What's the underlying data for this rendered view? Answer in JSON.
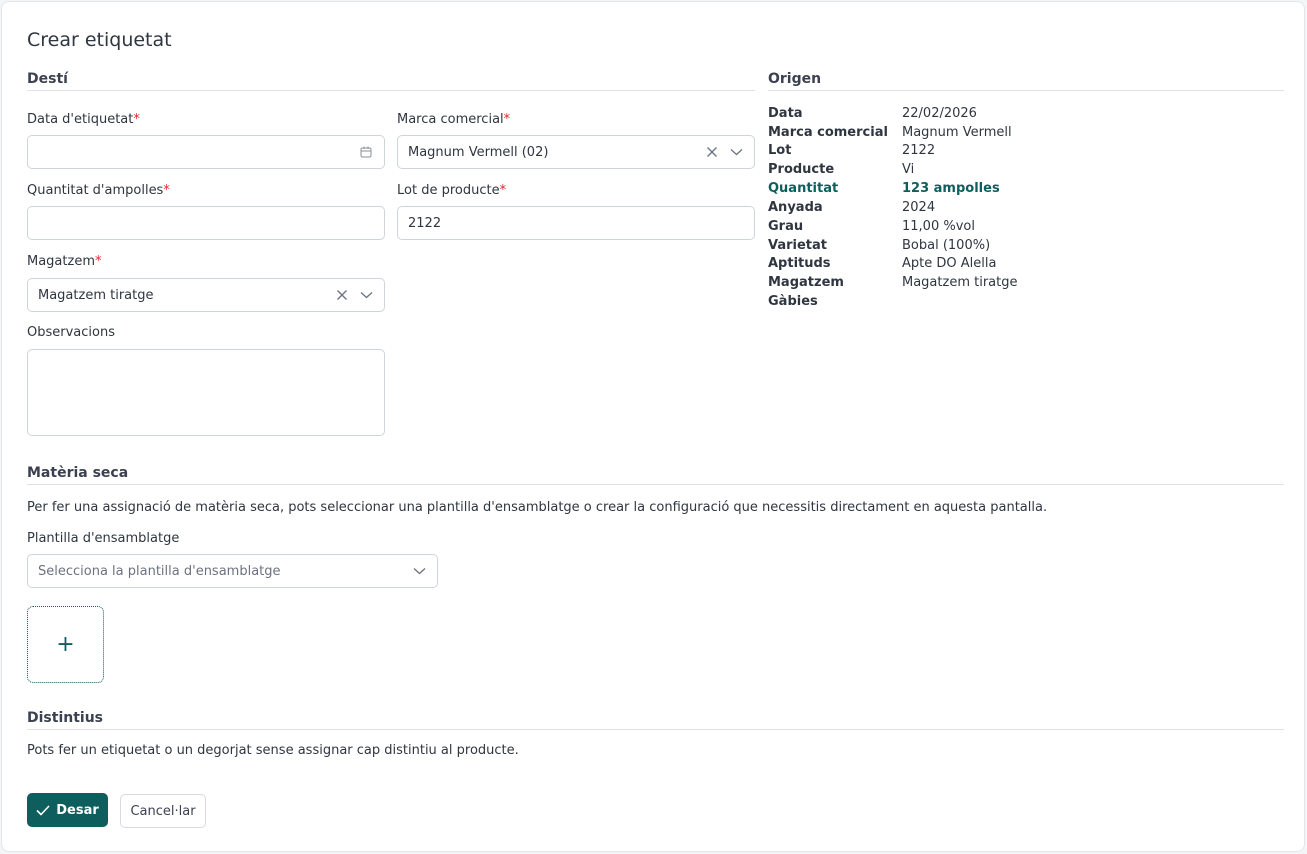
{
  "page": {
    "title": "Crear etiquetat"
  },
  "desti": {
    "title": "Destí",
    "data_etiquetat": {
      "label": "Data d'etiquetat",
      "value": ""
    },
    "marca_comercial": {
      "label": "Marca comercial",
      "value": "Magnum Vermell (02)"
    },
    "quantitat_ampolles": {
      "label": "Quantitat d'ampolles",
      "value": ""
    },
    "lot_producte": {
      "label": "Lot de producte",
      "value": "2122"
    },
    "magatzem": {
      "label": "Magatzem",
      "value": "Magatzem tiratge"
    },
    "observacions": {
      "label": "Observacions",
      "value": ""
    },
    "required_mark": "*"
  },
  "origen": {
    "title": "Origen",
    "rows": [
      {
        "key": "Data",
        "value": "22/02/2026"
      },
      {
        "key": "Marca comercial",
        "value": "Magnum Vermell"
      },
      {
        "key": "Lot",
        "value": "2122"
      },
      {
        "key": "Producte",
        "value": "Vi"
      },
      {
        "key": "Quantitat",
        "value": "123 ampolles"
      },
      {
        "key": "Anyada",
        "value": "2024"
      },
      {
        "key": "Grau",
        "value": "11,00 %vol"
      },
      {
        "key": "Varietat",
        "value": "Bobal (100%)"
      },
      {
        "key": "Aptituds",
        "value": "Apte DO Alella"
      },
      {
        "key": "Magatzem",
        "value": "Magatzem tiratge"
      },
      {
        "key": "Gàbies",
        "value": ""
      }
    ]
  },
  "materia_seca": {
    "title": "Matèria seca",
    "description": "Per fer una assignació de matèria seca, pots seleccionar una plantilla d'ensamblatge o crear la configuració que necessitis directament en aquesta pantalla.",
    "plantilla_label": "Plantilla d'ensamblatge",
    "plantilla_placeholder": "Selecciona la plantilla d'ensamblatge",
    "add_symbol": "+"
  },
  "distintius": {
    "title": "Distintius",
    "description": "Pots fer un etiquetat o un degorjat sense assignar cap distintiu al producte."
  },
  "actions": {
    "save": "Desar",
    "cancel": "Cancel·lar"
  },
  "colors": {
    "accent": "#0f5e5e",
    "required": "#e02424",
    "border": "#cfd4da"
  },
  "icons": [
    "calendar-icon",
    "clear-icon",
    "chevron-down-icon",
    "plus-icon",
    "check-icon"
  ]
}
